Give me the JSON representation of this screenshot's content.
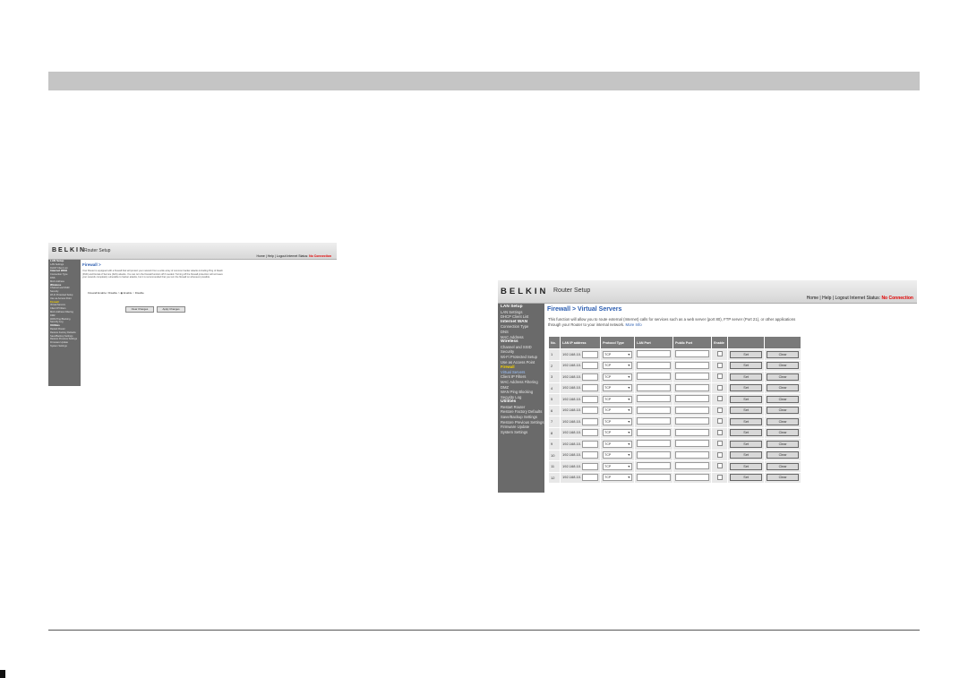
{
  "small_shot": {
    "logo": "BELKIN",
    "router_title": "Router Setup",
    "header_links": "Home | Help | Logout   Internet Status:",
    "status": "No Connection",
    "sidebar": [
      {
        "label": "LAN Setup",
        "kind": "sec"
      },
      {
        "label": "LAN Settings",
        "kind": "item"
      },
      {
        "label": "DHCP Client List",
        "kind": "item"
      },
      {
        "label": "Internet WAN",
        "kind": "sec"
      },
      {
        "label": "Connection Type",
        "kind": "item"
      },
      {
        "label": "DNS",
        "kind": "item"
      },
      {
        "label": "MAC Address",
        "kind": "item"
      },
      {
        "label": "Wireless",
        "kind": "sec"
      },
      {
        "label": "Channel and SSID",
        "kind": "item"
      },
      {
        "label": "Security",
        "kind": "item"
      },
      {
        "label": "Wi-Fi Protected Setup",
        "kind": "item"
      },
      {
        "label": "Use as Access Point",
        "kind": "item"
      },
      {
        "label": "Firewall",
        "kind": "hl"
      },
      {
        "label": "Virtual Servers",
        "kind": "item"
      },
      {
        "label": "Client IP Filters",
        "kind": "item"
      },
      {
        "label": "MAC Address Filtering",
        "kind": "item"
      },
      {
        "label": "DMZ",
        "kind": "item"
      },
      {
        "label": "WAN Ping Blocking",
        "kind": "item"
      },
      {
        "label": "Security Log",
        "kind": "item"
      },
      {
        "label": "Utilities",
        "kind": "sec"
      },
      {
        "label": "Restart Router",
        "kind": "item"
      },
      {
        "label": "Restore Factory Defaults",
        "kind": "item"
      },
      {
        "label": "Save/Backup Settings",
        "kind": "item"
      },
      {
        "label": "Restore Previous Settings",
        "kind": "item"
      },
      {
        "label": "Firmware Update",
        "kind": "item"
      },
      {
        "label": "System Settings",
        "kind": "item"
      }
    ],
    "page_title": "Firewall >",
    "description": "Your Router is equipped with a firewall that will protect your network from a wide array of common hacker attacks including Ping of Death (PoD) and Denial of Service (DoS) attacks. You can turn the firewall function off if needed. Turning off the firewall protection will not leave your network completely vulnerable to hacker attacks, but it is recommended that you turn the firewall on whenever possible.",
    "firewall_label": "Firewall Enable / Disable >",
    "enable": "Enable",
    "disable": "Disable",
    "clear_btn": "Clear Changes",
    "apply_btn": "Apply Changes"
  },
  "large_shot": {
    "logo": "BELKIN",
    "router_title": "Router Setup",
    "header_links": "Home | Help | Logout   Internet Status:",
    "status": "No Connection",
    "sidebar": [
      {
        "label": "LAN Setup",
        "kind": "sec"
      },
      {
        "label": "LAN Settings",
        "kind": "item"
      },
      {
        "label": "DHCP Client List",
        "kind": "item"
      },
      {
        "label": "Internet WAN",
        "kind": "sec"
      },
      {
        "label": "Connection Type",
        "kind": "item"
      },
      {
        "label": "DNS",
        "kind": "item"
      },
      {
        "label": "MAC Address",
        "kind": "item"
      },
      {
        "label": "Wireless",
        "kind": "sec"
      },
      {
        "label": "Channel and SSID",
        "kind": "item"
      },
      {
        "label": "Security",
        "kind": "item"
      },
      {
        "label": "Wi-Fi Protected Setup",
        "kind": "item"
      },
      {
        "label": "Use as Access Point",
        "kind": "item"
      },
      {
        "label": "Firewall",
        "kind": "hl"
      },
      {
        "label": "Virtual Servers",
        "kind": "cur"
      },
      {
        "label": "Client IP Filters",
        "kind": "item"
      },
      {
        "label": "MAC Address Filtering",
        "kind": "item"
      },
      {
        "label": "DMZ",
        "kind": "item"
      },
      {
        "label": "WAN Ping Blocking",
        "kind": "item"
      },
      {
        "label": "Security Log",
        "kind": "item"
      },
      {
        "label": "Utilities",
        "kind": "sec"
      },
      {
        "label": "Restart Router",
        "kind": "item"
      },
      {
        "label": "Restore Factory Defaults",
        "kind": "item"
      },
      {
        "label": "Save/Backup Settings",
        "kind": "item"
      },
      {
        "label": "Restore Previous Settings",
        "kind": "item"
      },
      {
        "label": "Firmware Update",
        "kind": "item"
      },
      {
        "label": "System Settings",
        "kind": "item"
      }
    ],
    "page_title": "Firewall > Virtual Servers",
    "description": "This function will allow you to route external (Internet) calls for services such as a web server (port 80), FTP server (Port 21), or other applications through your Router to your internal network.",
    "more_info": "More Info",
    "table": {
      "headers": [
        "No.",
        "LAN IP address",
        "Protocol Type",
        "LAN Port",
        "Public Port",
        "Enable",
        "",
        ""
      ],
      "ip_prefix": "192.168.10.",
      "protocol": "TCP",
      "set_label": "Set",
      "clear_label": "Clear",
      "rows": [
        "1",
        "2",
        "3",
        "4",
        "5",
        "6",
        "7",
        "8",
        "9",
        "10",
        "11",
        "12"
      ]
    }
  }
}
